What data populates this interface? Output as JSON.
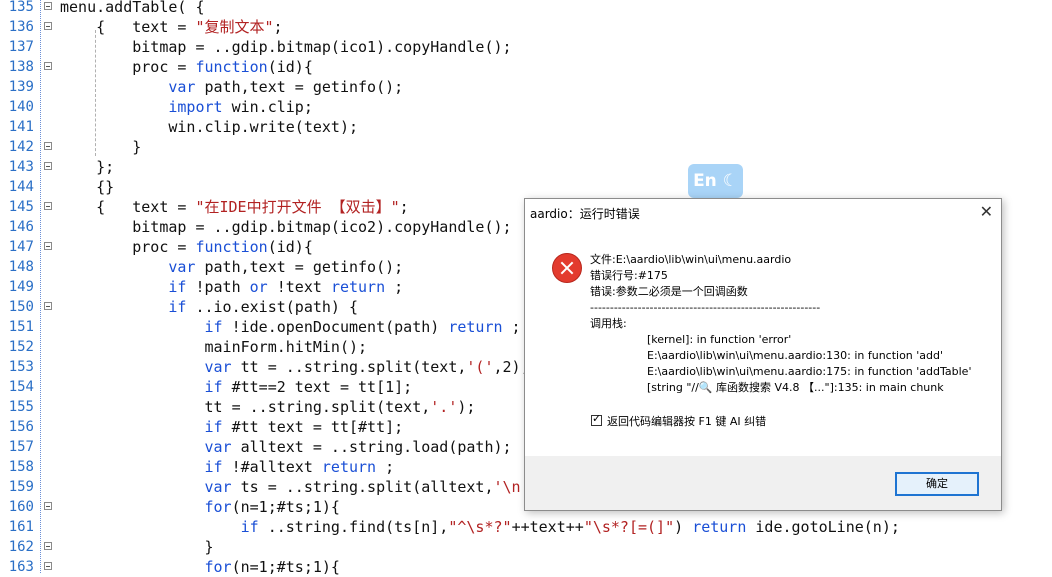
{
  "editor": {
    "lines": [
      {
        "n": "135",
        "fold": true
      },
      {
        "n": "136",
        "fold": true
      },
      {
        "n": "137",
        "fold": false
      },
      {
        "n": "138",
        "fold": true
      },
      {
        "n": "139",
        "fold": false
      },
      {
        "n": "140",
        "fold": false
      },
      {
        "n": "141",
        "fold": false
      },
      {
        "n": "142",
        "fold": true
      },
      {
        "n": "143",
        "fold": true
      },
      {
        "n": "144",
        "fold": false
      },
      {
        "n": "145",
        "fold": true
      },
      {
        "n": "146",
        "fold": false
      },
      {
        "n": "147",
        "fold": true
      },
      {
        "n": "148",
        "fold": false
      },
      {
        "n": "149",
        "fold": false
      },
      {
        "n": "150",
        "fold": true
      },
      {
        "n": "151",
        "fold": false
      },
      {
        "n": "152",
        "fold": false
      },
      {
        "n": "153",
        "fold": false
      },
      {
        "n": "154",
        "fold": false
      },
      {
        "n": "155",
        "fold": false
      },
      {
        "n": "156",
        "fold": false
      },
      {
        "n": "157",
        "fold": false
      },
      {
        "n": "158",
        "fold": false
      },
      {
        "n": "159",
        "fold": false
      },
      {
        "n": "160",
        "fold": true
      },
      {
        "n": "161",
        "fold": false
      },
      {
        "n": "162",
        "fold": true
      },
      {
        "n": "163",
        "fold": true
      }
    ],
    "code": [
      [
        {
          "t": "menu.addTable( {"
        }
      ],
      [
        {
          "t": "    {   text = "
        },
        {
          "t": "\"复制文本\"",
          "c": "s"
        },
        {
          "t": ";"
        }
      ],
      [
        {
          "t": "        bitmap = ..gdip.bitmap(ico1).copyHandle();"
        }
      ],
      [
        {
          "t": "        proc = "
        },
        {
          "t": "function",
          "c": "k"
        },
        {
          "t": "(id){"
        }
      ],
      [
        {
          "t": "            "
        },
        {
          "t": "var",
          "c": "k"
        },
        {
          "t": " path,text = getinfo();"
        }
      ],
      [
        {
          "t": "            "
        },
        {
          "t": "import",
          "c": "k"
        },
        {
          "t": " win.clip;"
        }
      ],
      [
        {
          "t": "            win.clip.write(text);"
        }
      ],
      [
        {
          "t": "        }"
        }
      ],
      [
        {
          "t": "    };"
        }
      ],
      [
        {
          "t": "    {}"
        }
      ],
      [
        {
          "t": "    {   text = "
        },
        {
          "t": "\"在IDE中打开文件 【双击】\"",
          "c": "s"
        },
        {
          "t": ";"
        }
      ],
      [
        {
          "t": "        bitmap = ..gdip.bitmap(ico2).copyHandle();"
        }
      ],
      [
        {
          "t": "        proc = "
        },
        {
          "t": "function",
          "c": "k"
        },
        {
          "t": "(id){"
        }
      ],
      [
        {
          "t": "            "
        },
        {
          "t": "var",
          "c": "k"
        },
        {
          "t": " path,text = getinfo();"
        }
      ],
      [
        {
          "t": "            "
        },
        {
          "t": "if",
          "c": "k"
        },
        {
          "t": " !path "
        },
        {
          "t": "or",
          "c": "k"
        },
        {
          "t": " !text "
        },
        {
          "t": "return",
          "c": "k"
        },
        {
          "t": " ;"
        }
      ],
      [
        {
          "t": "            "
        },
        {
          "t": "if",
          "c": "k"
        },
        {
          "t": " ..io.exist(path) {"
        }
      ],
      [
        {
          "t": "                "
        },
        {
          "t": "if",
          "c": "k"
        },
        {
          "t": " !ide.openDocument(path) "
        },
        {
          "t": "return",
          "c": "k"
        },
        {
          "t": " ;"
        }
      ],
      [
        {
          "t": "                mainForm.hitMin();"
        }
      ],
      [
        {
          "t": "                "
        },
        {
          "t": "var",
          "c": "k"
        },
        {
          "t": " tt = ..string.split(text,"
        },
        {
          "t": "'('",
          "c": "s"
        },
        {
          "t": ",2);"
        }
      ],
      [
        {
          "t": "                "
        },
        {
          "t": "if",
          "c": "k"
        },
        {
          "t": " #tt==2 text = tt[1];"
        }
      ],
      [
        {
          "t": "                tt = ..string.split(text,"
        },
        {
          "t": "'.'",
          "c": "s"
        },
        {
          "t": ");"
        }
      ],
      [
        {
          "t": "                "
        },
        {
          "t": "if",
          "c": "k"
        },
        {
          "t": " #tt text = tt[#tt];"
        }
      ],
      [
        {
          "t": "                "
        },
        {
          "t": "var",
          "c": "k"
        },
        {
          "t": " alltext = ..string.load(path);"
        }
      ],
      [
        {
          "t": "                "
        },
        {
          "t": "if",
          "c": "k"
        },
        {
          "t": " !#alltext "
        },
        {
          "t": "return",
          "c": "k"
        },
        {
          "t": " ;"
        }
      ],
      [
        {
          "t": "                "
        },
        {
          "t": "var",
          "c": "k"
        },
        {
          "t": " ts = ..string.split(alltext,"
        },
        {
          "t": "'\\n'",
          "c": "s"
        }
      ],
      [
        {
          "t": "                "
        },
        {
          "t": "for",
          "c": "k"
        },
        {
          "t": "(n=1;#ts;1){"
        }
      ],
      [
        {
          "t": "                    "
        },
        {
          "t": "if",
          "c": "k"
        },
        {
          "t": " ..string.find(ts[n],"
        },
        {
          "t": "\"^\\s*?\"",
          "c": "s"
        },
        {
          "t": "++text++"
        },
        {
          "t": "\"\\s*?[=(]\"",
          "c": "s"
        },
        {
          "t": ") "
        },
        {
          "t": "return",
          "c": "k"
        },
        {
          "t": " ide.gotoLine(n);"
        }
      ],
      [
        {
          "t": "                }"
        }
      ],
      [
        {
          "t": "                "
        },
        {
          "t": "for",
          "c": "k"
        },
        {
          "t": "(n=1;#ts;1){"
        }
      ]
    ]
  },
  "ime_badge": {
    "label": "En ☾"
  },
  "dialog": {
    "title": "aardio：运行时错误",
    "close_label": "✕",
    "file_line": "文件:E:\\aardio\\lib\\win\\ui\\menu.aardio",
    "lineno_line": "错误行号:#175",
    "error_line": "错误:参数二必须是一个回调函数",
    "separator": "----------------------------------------------------------",
    "stack_label": "调用栈:",
    "stack": [
      "[kernel]: in function 'error'",
      "E:\\aardio\\lib\\win\\ui\\menu.aardio:130: in function 'add'",
      "E:\\aardio\\lib\\win\\ui\\menu.aardio:175: in function 'addTable'",
      "[string \"//🔍 库函数搜索 V4.8 【...\"]:135: in main chunk"
    ],
    "checkbox_label": "返回代码编辑器按 F1 键 AI 纠错",
    "checkbox_checked": true,
    "ok_label": "确定"
  }
}
